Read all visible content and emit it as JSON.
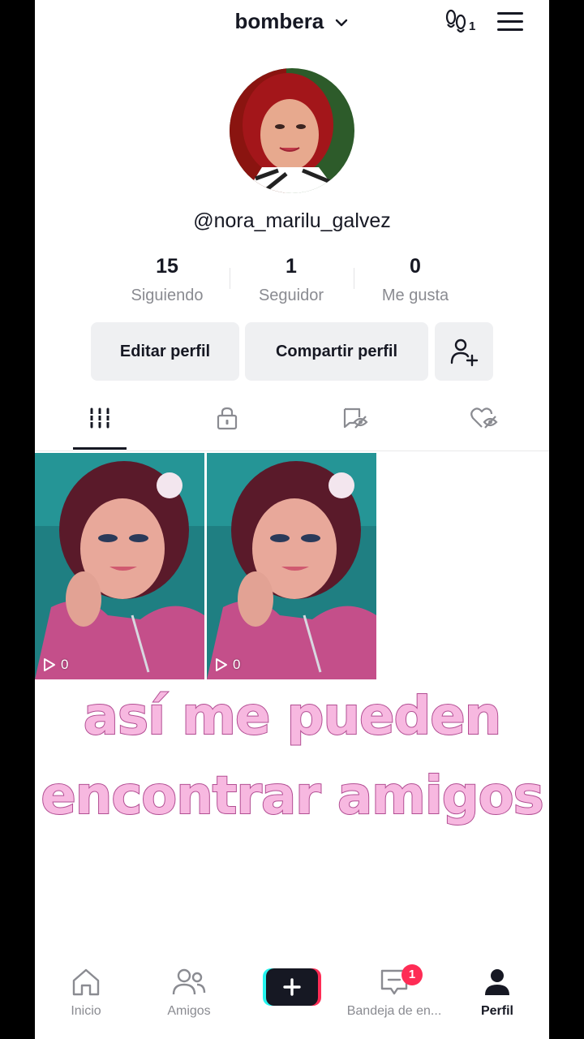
{
  "header": {
    "username": "bombera",
    "footprint_badge": "1"
  },
  "profile": {
    "handle": "@nora_marilu_galvez"
  },
  "stats": [
    {
      "value": "15",
      "label": "Siguiendo"
    },
    {
      "value": "1",
      "label": "Seguidor"
    },
    {
      "value": "0",
      "label": "Me gusta"
    }
  ],
  "actions": {
    "edit": "Editar perfil",
    "share": "Compartir perfil"
  },
  "videos": [
    {
      "plays": "0"
    },
    {
      "plays": "0"
    }
  ],
  "caption": {
    "line1": "así me pueden",
    "line2": "encontrar amigos"
  },
  "nav": {
    "home": "Inicio",
    "friends": "Amigos",
    "inbox": "Bandeja de en...",
    "inbox_badge": "1",
    "profile": "Perfil"
  },
  "colors": {
    "accent": "#fe2c55",
    "caption_fill": "#f7b8e0",
    "caption_stroke": "#b24e93"
  }
}
